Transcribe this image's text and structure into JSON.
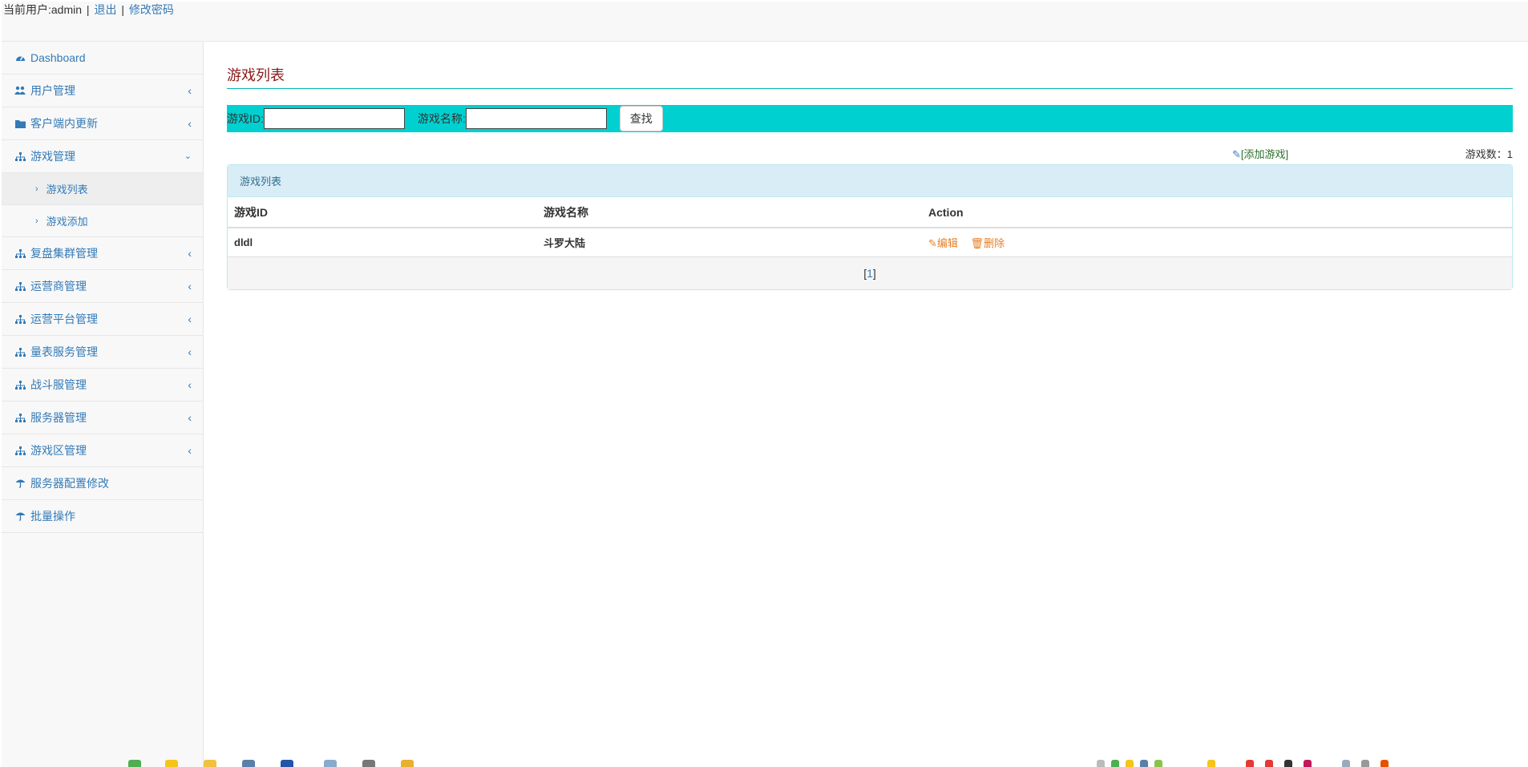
{
  "header": {
    "current_user": "当前用户:admin",
    "logout": "退出",
    "change_password": "修改密码"
  },
  "sidebar": {
    "items": [
      {
        "label": "Dashboard",
        "icon": "dashboard-icon"
      },
      {
        "label": "用户管理",
        "icon": "users-icon"
      },
      {
        "label": "客户端内更新",
        "icon": "folder-icon"
      },
      {
        "label": "游戏管理",
        "icon": "sitemap-icon"
      },
      {
        "label": "复盘集群管理",
        "icon": "sitemap-icon"
      },
      {
        "label": "运营商管理",
        "icon": "sitemap-icon"
      },
      {
        "label": "运营平台管理",
        "icon": "sitemap-icon"
      },
      {
        "label": "量表服务管理",
        "icon": "sitemap-icon"
      },
      {
        "label": "战斗服管理",
        "icon": "sitemap-icon"
      },
      {
        "label": "服务器管理",
        "icon": "sitemap-icon"
      },
      {
        "label": "游戏区管理",
        "icon": "sitemap-icon"
      },
      {
        "label": "服务器配置修改",
        "icon": "umbrella-icon"
      },
      {
        "label": "批量操作",
        "icon": "umbrella-icon"
      }
    ],
    "sub_items": [
      {
        "label": "游戏列表"
      },
      {
        "label": "游戏添加"
      }
    ]
  },
  "main": {
    "title": "游戏列表",
    "search": {
      "game_id_label": "游戏ID:",
      "game_id_value": "",
      "game_name_label": "游戏名称:",
      "game_name_value": "",
      "button": "查找"
    },
    "add_game": "[添加游戏]",
    "game_count": "游戏数：1",
    "panel_title": "游戏列表",
    "table": {
      "headers": [
        "游戏ID",
        "游戏名称",
        "Action"
      ],
      "rows": [
        {
          "id": "dldl",
          "name": "斗罗大陆",
          "edit": "编辑",
          "delete": "删除"
        }
      ]
    },
    "pagination": {
      "prefix": "[",
      "page": "1",
      "suffix": " ]"
    }
  },
  "colors": {
    "accent": "#00d0d0",
    "link": "#337ab7",
    "title": "#8b1a1a",
    "action": "#e67e22"
  }
}
